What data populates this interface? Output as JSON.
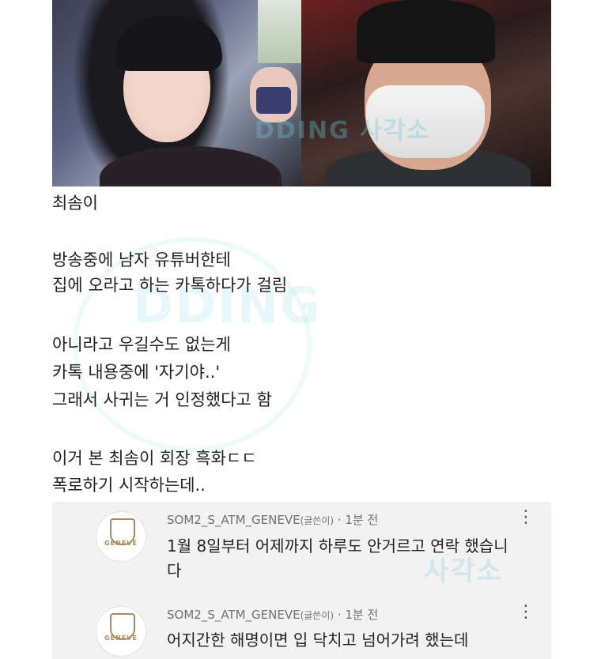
{
  "watermark": {
    "text": "DDING 사각소"
  },
  "post": {
    "lines": [
      "최솜이",
      "방송중에 남자 유튜버한테",
      "집에 오라고 하는 카톡하다가 걸림",
      "아니라고 우길수도 없는게",
      "카톡 내용중에 '자기야..'",
      "그래서 사귀는 거 인정했다고 함",
      "이거 본 최솜이 회장 흑화ㄷㄷ",
      "폭로하기 시작하는데.."
    ]
  },
  "comments": [
    {
      "user": "SOM2_S_ATM_GENEVE",
      "role": "(글쓴이)",
      "time": "· 1분 전",
      "text_line1": "1월 8일부터 어제까지 하루도 안거르고 연락 했습니",
      "text_line2": "다",
      "avatar_text": "GENEVE"
    },
    {
      "user": "SOM2_S_ATM_GENEVE",
      "role": "(글쓴이)",
      "time": "· 1분 전",
      "text_line1": "어지간한 해명이면 입 닥치고 넘어가려 했는데",
      "text_line2": "",
      "avatar_text": "GENEVE"
    }
  ],
  "colors": {
    "comment_bg": "#f2f2f2",
    "watermark": "#6ec8d2",
    "avatar_gold": "#a88b5a"
  }
}
